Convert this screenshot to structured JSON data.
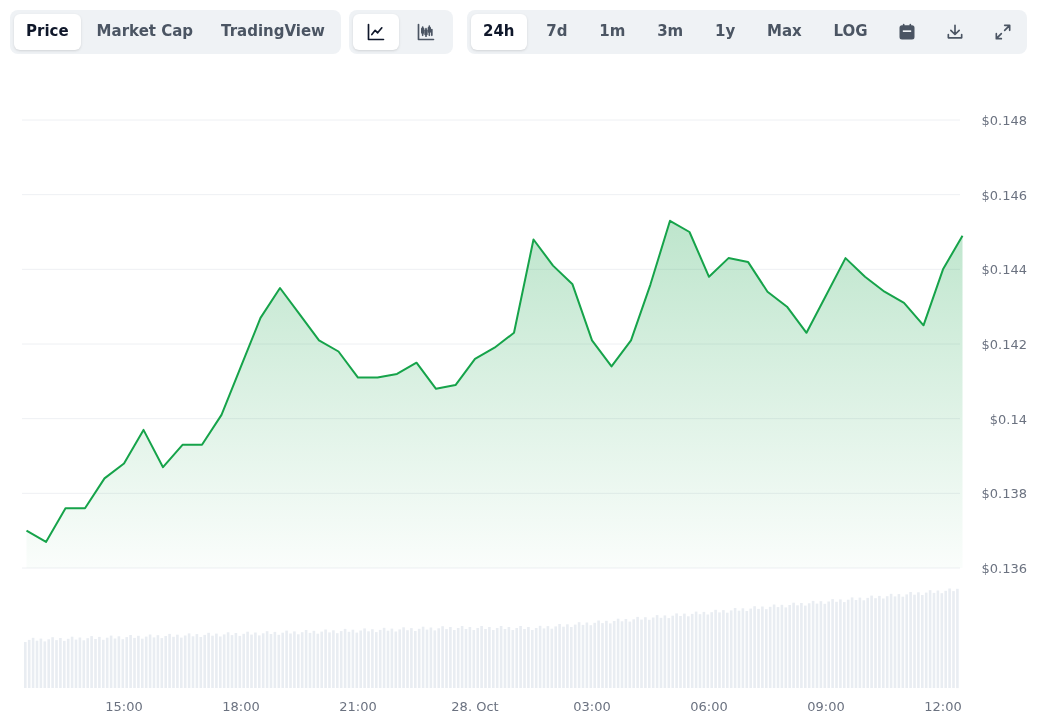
{
  "tabs": [
    {
      "label": "Price",
      "selected": true
    },
    {
      "label": "Market Cap",
      "selected": false
    },
    {
      "label": "TradingView",
      "selected": false
    }
  ],
  "chart_types": [
    {
      "kind": "line",
      "selected": true
    },
    {
      "kind": "candlestick",
      "selected": false
    }
  ],
  "ranges": [
    {
      "label": "24h",
      "selected": true
    },
    {
      "label": "7d",
      "selected": false
    },
    {
      "label": "1m",
      "selected": false
    },
    {
      "label": "3m",
      "selected": false
    },
    {
      "label": "1y",
      "selected": false
    },
    {
      "label": "Max",
      "selected": false
    },
    {
      "label": "LOG",
      "selected": false
    }
  ],
  "actions": [
    {
      "kind": "calendar"
    },
    {
      "kind": "download"
    },
    {
      "kind": "expand"
    }
  ],
  "chart": {
    "x_axis_labels": [
      "15:00",
      "18:00",
      "21:00",
      "28. Oct",
      "03:00",
      "06:00",
      "09:00",
      "12:00"
    ],
    "chart_data": {
      "type": "area",
      "ylim": [
        0.136,
        0.148
      ],
      "grid": true,
      "yticks": [
        {
          "value": 0.136,
          "label": "$0.136"
        },
        {
          "value": 0.138,
          "label": "$0.138"
        },
        {
          "value": 0.14,
          "label": "$0.14"
        },
        {
          "value": 0.142,
          "label": "$0.142"
        },
        {
          "value": 0.144,
          "label": "$0.144"
        },
        {
          "value": 0.146,
          "label": "$0.146"
        },
        {
          "value": 0.148,
          "label": "$0.148"
        }
      ],
      "series": [
        {
          "color": "#16a34a",
          "values": [
            0.137,
            0.1367,
            0.1376,
            0.1376,
            0.1384,
            0.1388,
            0.1397,
            0.1387,
            0.1393,
            0.1393,
            0.1401,
            0.1414,
            0.1427,
            0.1435,
            0.1428,
            0.1421,
            0.1418,
            0.1411,
            0.1411,
            0.1412,
            0.1415,
            0.1408,
            0.1409,
            0.1416,
            0.1419,
            0.1423,
            0.1448,
            0.1441,
            0.1436,
            0.1421,
            0.1414,
            0.1421,
            0.1436,
            0.1453,
            0.145,
            0.1438,
            0.1443,
            0.1442,
            0.1434,
            0.143,
            0.1423,
            0.1433,
            0.1443,
            0.1438,
            0.1434,
            0.1431,
            0.1425,
            0.144,
            0.1449
          ]
        }
      ]
    }
  }
}
